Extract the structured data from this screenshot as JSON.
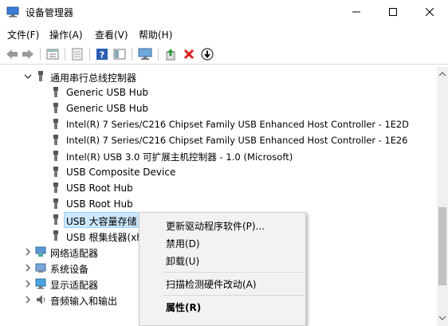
{
  "window": {
    "title": "设备管理器",
    "icons": {
      "app": "device-manager-icon",
      "minimize": "minimize-icon",
      "maximize": "maximize-icon",
      "close": "close-icon"
    }
  },
  "menubar": {
    "items": [
      {
        "label": "文件(F)"
      },
      {
        "label": "操作(A)"
      },
      {
        "label": "查看(V)"
      },
      {
        "label": "帮助(H)"
      }
    ]
  },
  "toolbar": {
    "buttons": [
      "back-arrow-icon",
      "forward-arrow-icon",
      "properties-sheet-icon",
      "driver-doc-icon",
      "help-icon",
      "view-pane-icon",
      "monitor-scan-icon",
      "update-driver-icon",
      "uninstall-x-icon",
      "disable-icon"
    ]
  },
  "tree": {
    "category_usb": "通用串行总线控制器",
    "usb_children": [
      "Generic USB Hub",
      "Generic USB Hub",
      "Intel(R) 7 Series/C216 Chipset Family USB Enhanced Host Controller - 1E2D",
      "Intel(R) 7 Series/C216 Chipset Family USB Enhanced Host Controller - 1E26",
      "Intel(R) USB 3.0 可扩展主机控制器 - 1.0 (Microsoft)",
      "USB Composite Device",
      "USB Root Hub",
      "USB Root Hub",
      "USB 大容量存储",
      "USB 根集线器(xh"
    ],
    "categories_collapsed": [
      "网络适配器",
      "系统设备",
      "显示适配器",
      "音频输入和输出"
    ]
  },
  "context_menu": {
    "update_driver": "更新驱动程序软件(P)...",
    "disable": "禁用(D)",
    "uninstall": "卸载(U)",
    "scan": "扫描检测硬件改动(A)",
    "properties": "属性(R)"
  },
  "colors": {
    "selection": "#cce8ff",
    "menu_bg": "#f2f2f2",
    "red_x": "#d81e1e"
  }
}
